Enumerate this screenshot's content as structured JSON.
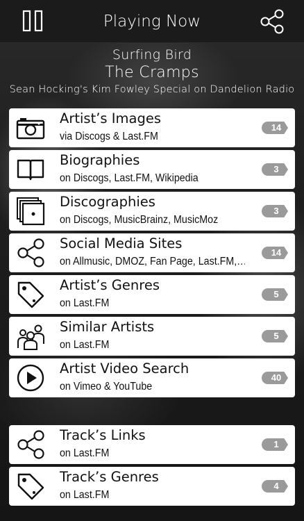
{
  "header": {
    "title": "Playing Now",
    "left_icon": "pause-icon",
    "right_icon": "share-icon"
  },
  "now_playing": {
    "track": "Surfing Bird",
    "artist": "The Cramps",
    "station": "Sean Hocking's Kim Fowley Special on Dandelion Radio"
  },
  "artist_items": [
    {
      "label": "Artist’s Images",
      "sub": "via Discogs & Last.FM",
      "count": "14",
      "icon": "camera-icon"
    },
    {
      "label": "Biographies",
      "sub": "on Discogs, Last.FM, Wikipedia",
      "count": "3",
      "icon": "book-icon"
    },
    {
      "label": "Discographies",
      "sub": "on Discogs, MusicBrainz, MusicMoz",
      "count": "3",
      "icon": "records-icon"
    },
    {
      "label": "Social Media Sites",
      "sub": "on Allmusic, DMOZ, Fan Page, Last.FM,…",
      "count": "14",
      "icon": "share-icon"
    },
    {
      "label": "Artist’s Genres",
      "sub": "on Last.FM",
      "count": "5",
      "icon": "tag-icon"
    },
    {
      "label": "Similar Artists",
      "sub": "on Last.FM",
      "count": "5",
      "icon": "people-icon"
    },
    {
      "label": "Artist Video Search",
      "sub": "on Vimeo & YouTube",
      "count": "40",
      "icon": "play-icon"
    }
  ],
  "track_items": [
    {
      "label": "Track’s Links",
      "sub": "on Last.FM",
      "count": "1",
      "icon": "share-icon"
    },
    {
      "label": "Track’s Genres",
      "sub": "on Last.FM",
      "count": "4",
      "icon": "tag-icon"
    }
  ],
  "colors": {
    "navbar": "#1b1b1b",
    "row_bg": "#ffffff",
    "badge": "#9a9a9a",
    "text_light": "#ffffff"
  }
}
